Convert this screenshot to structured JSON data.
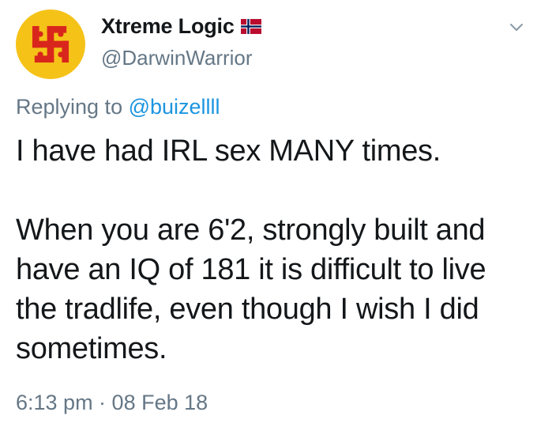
{
  "author": {
    "display_name": "Xtreme Logic",
    "handle": "@DarwinWarrior",
    "avatar_icon": "swastika-icon",
    "avatar_bg": "#f5c218",
    "avatar_fg": "#d9261c",
    "flag_icon": "norway-flag-icon"
  },
  "reply": {
    "prefix": "Replying to ",
    "mention": "@buizellll"
  },
  "body": {
    "line1": "I have had IRL sex MANY times.",
    "paragraph2": "When you are 6'2, strongly built and have an IQ of 181 it is difficult to live the tradlife, even though I wish I did sometimes."
  },
  "meta": {
    "timestamp": "6:13 pm · 08 Feb 18"
  },
  "colors": {
    "text": "#14171a",
    "secondary": "#657786",
    "link": "#1b95e0"
  }
}
